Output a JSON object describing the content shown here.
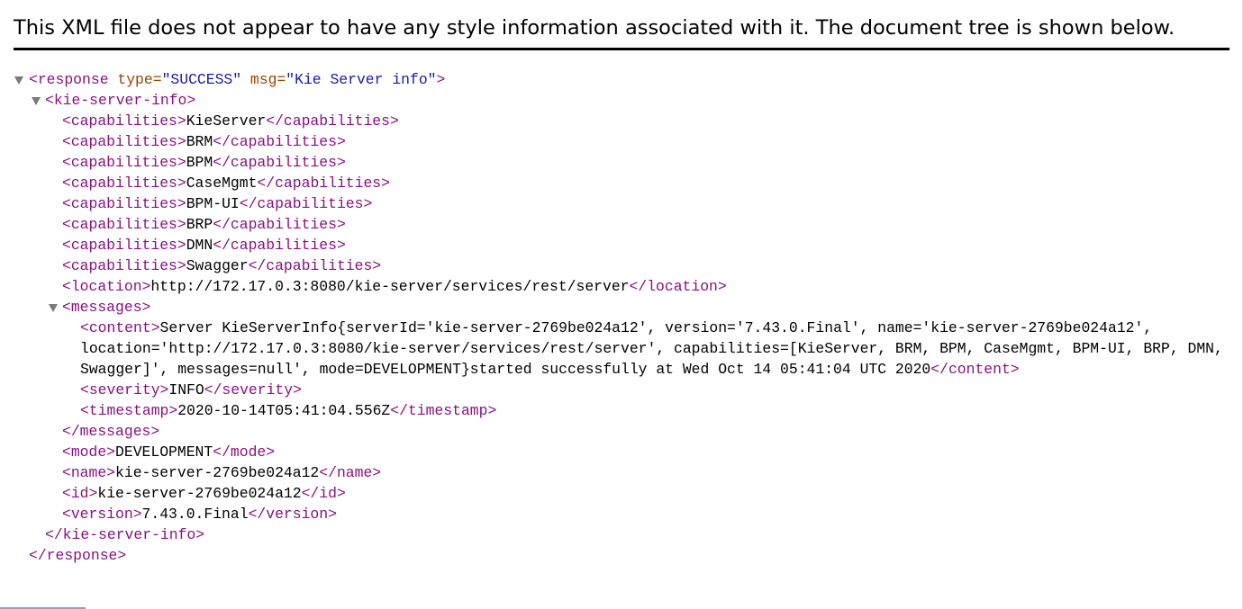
{
  "header": {
    "notice": "This XML file does not appear to have any style information associated with it. The document tree is shown below."
  },
  "xml": {
    "response_open": "<response ",
    "type_attr": "type=",
    "type_val": "\"SUCCESS\"",
    "msg_attr": " msg=",
    "msg_val": "\"Kie Server info\"",
    "response_close_gt": ">",
    "kie_open": "<kie-server-info>",
    "cap_open": "<capabilities>",
    "cap_close": "</capabilities>",
    "capabilities": [
      "KieServer",
      "BRM",
      "BPM",
      "CaseMgmt",
      "BPM-UI",
      "BRP",
      "DMN",
      "Swagger"
    ],
    "location_open": "<location>",
    "location_value": "http://172.17.0.3:8080/kie-server/services/rest/server",
    "location_close": "</location>",
    "messages_open": "<messages>",
    "content_open": "<content>",
    "content_lines": [
      "Server KieServerInfo{serverId='kie-server-2769be024a12', version='7.43.0.Final', name='kie-server-2769be024a12',",
      "location='http://172.17.0.3:8080/kie-server/services/rest/server', capabilities=[KieServer, BRM, BPM, CaseMgmt, BPM-UI, BRP, DMN,",
      "Swagger]', messages=null', mode=DEVELOPMENT}started successfully at Wed Oct 14 05:41:04 UTC 2020"
    ],
    "content_close": "</content>",
    "severity_open": "<severity>",
    "severity_value": "INFO",
    "severity_close": "</severity>",
    "timestamp_open": "<timestamp>",
    "timestamp_value": "2020-10-14T05:41:04.556Z",
    "timestamp_close": "</timestamp>",
    "messages_close": "</messages>",
    "mode_open": "<mode>",
    "mode_value": "DEVELOPMENT",
    "mode_close": "</mode>",
    "name_open": "<name>",
    "name_value": "kie-server-2769be024a12",
    "name_close": "</name>",
    "id_open": "<id>",
    "id_value": "kie-server-2769be024a12",
    "id_close": "</id>",
    "version_open": "<version>",
    "version_value": "7.43.0.Final",
    "version_close": "</version>",
    "kie_close": "</kie-server-info>",
    "response_close": "</response>"
  },
  "colors": {
    "tag": "#881280",
    "attribute_name": "#994500",
    "attribute_value": "#1a1aa6",
    "text": "#000000",
    "toggle": "#7a7a7a"
  },
  "icons": {
    "toggle": "disclosure-triangle-down"
  }
}
